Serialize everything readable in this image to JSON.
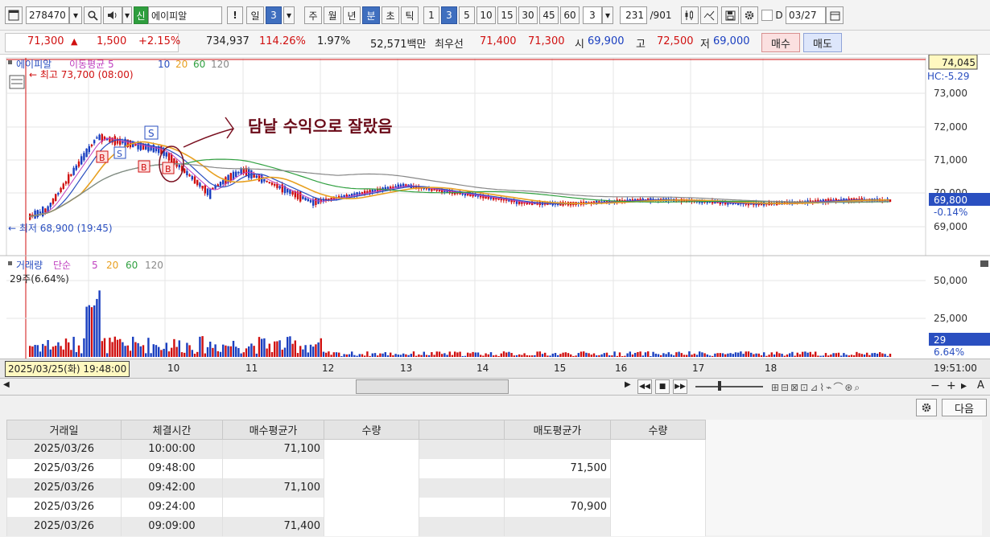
{
  "toolbar": {
    "stock_code": "278470",
    "credit_badge": "신",
    "stock_name": "에이피알",
    "warn_label": "!",
    "period_day": "일",
    "period_num": "3",
    "period_week": "주",
    "period_month": "월",
    "period_year": "년",
    "period_minute": "분",
    "period_second": "초",
    "period_tick": "틱",
    "intervals": [
      "1",
      "3",
      "5",
      "10",
      "15",
      "30",
      "45",
      "60"
    ],
    "interval_value": "3",
    "count_value": "231",
    "count_total": "/901",
    "date_check_label": "D",
    "date_value": "03/27"
  },
  "quote": {
    "price": "71,300",
    "change": "1,500",
    "change_pct": "+2.15%",
    "volume": "734,937",
    "volume_ratio": "114.26%",
    "turnover_rate": "1.97%",
    "amount": "52,571백만",
    "best_label": "최우선",
    "best_ask": "71,400",
    "best_bid": "71,300",
    "open_label": "시",
    "open": "69,900",
    "high_label": "고",
    "high": "72,500",
    "low_label": "저",
    "low": "69,000",
    "buy_label": "매수",
    "sell_label": "매도"
  },
  "chart_legend": {
    "name": "에이피알",
    "ma_label": "이동평균 5",
    "ma_values": [
      "10",
      "20",
      "60",
      "120"
    ],
    "high_marker": "최고 73,700 (08:00)",
    "low_marker": "최저 68,900 (19:45)",
    "current_price_tag": "74,045",
    "hc_label": "HC:-5.29",
    "last_price_tag": "69,800",
    "last_pct_tag": "-0.14%",
    "price_ticks": [
      "73,000",
      "72,000",
      "71,000",
      "70,000",
      "69,000"
    ],
    "annotation": "담날 수익으로 잘랐음",
    "sell_marker": "S",
    "buy_marker": "B"
  },
  "volume_legend": {
    "name": "거래량",
    "type_label": "단순",
    "ma_values": [
      "5",
      "20",
      "60",
      "120"
    ],
    "vol_info": "29주(6.64%)",
    "vol_ticks": [
      "50,000",
      "25,000"
    ],
    "last_vol_tag": "29",
    "last_vol_pct_tag": "6.64%"
  },
  "time_axis": {
    "cursor_label": "2025/03/25(화) 19:48:00",
    "hours": [
      "10",
      "11",
      "12",
      "13",
      "14",
      "15",
      "16",
      "17",
      "18"
    ],
    "end_time": "19:51:00"
  },
  "panel": {
    "next_label": "다음",
    "columns": [
      "거래일",
      "체결시간",
      "매수평균가",
      "수량",
      "",
      "매도평균가",
      "수량"
    ],
    "rows": [
      {
        "date": "2025/03/26",
        "time": "10:00:00",
        "buy_avg": "71,100",
        "buy_qty": "",
        "sell_avg": "",
        "sell_qty": ""
      },
      {
        "date": "2025/03/26",
        "time": "09:48:00",
        "buy_avg": "",
        "buy_qty": "",
        "sell_avg": "71,500",
        "sell_qty": ""
      },
      {
        "date": "2025/03/26",
        "time": "09:42:00",
        "buy_avg": "71,100",
        "buy_qty": "",
        "sell_avg": "",
        "sell_qty": ""
      },
      {
        "date": "2025/03/26",
        "time": "09:24:00",
        "buy_avg": "",
        "buy_qty": "",
        "sell_avg": "70,900",
        "sell_qty": ""
      },
      {
        "date": "2025/03/26",
        "time": "09:09:00",
        "buy_avg": "71,400",
        "buy_qty": "",
        "sell_avg": "",
        "sell_qty": ""
      }
    ]
  },
  "colors": {
    "up": "#d01010",
    "down": "#1a3fc0",
    "ma5": "#c040c0",
    "ma10": "#2a4fc0",
    "ma20": "#e8a020",
    "ma60": "#30a040",
    "ma120": "#888888"
  }
}
